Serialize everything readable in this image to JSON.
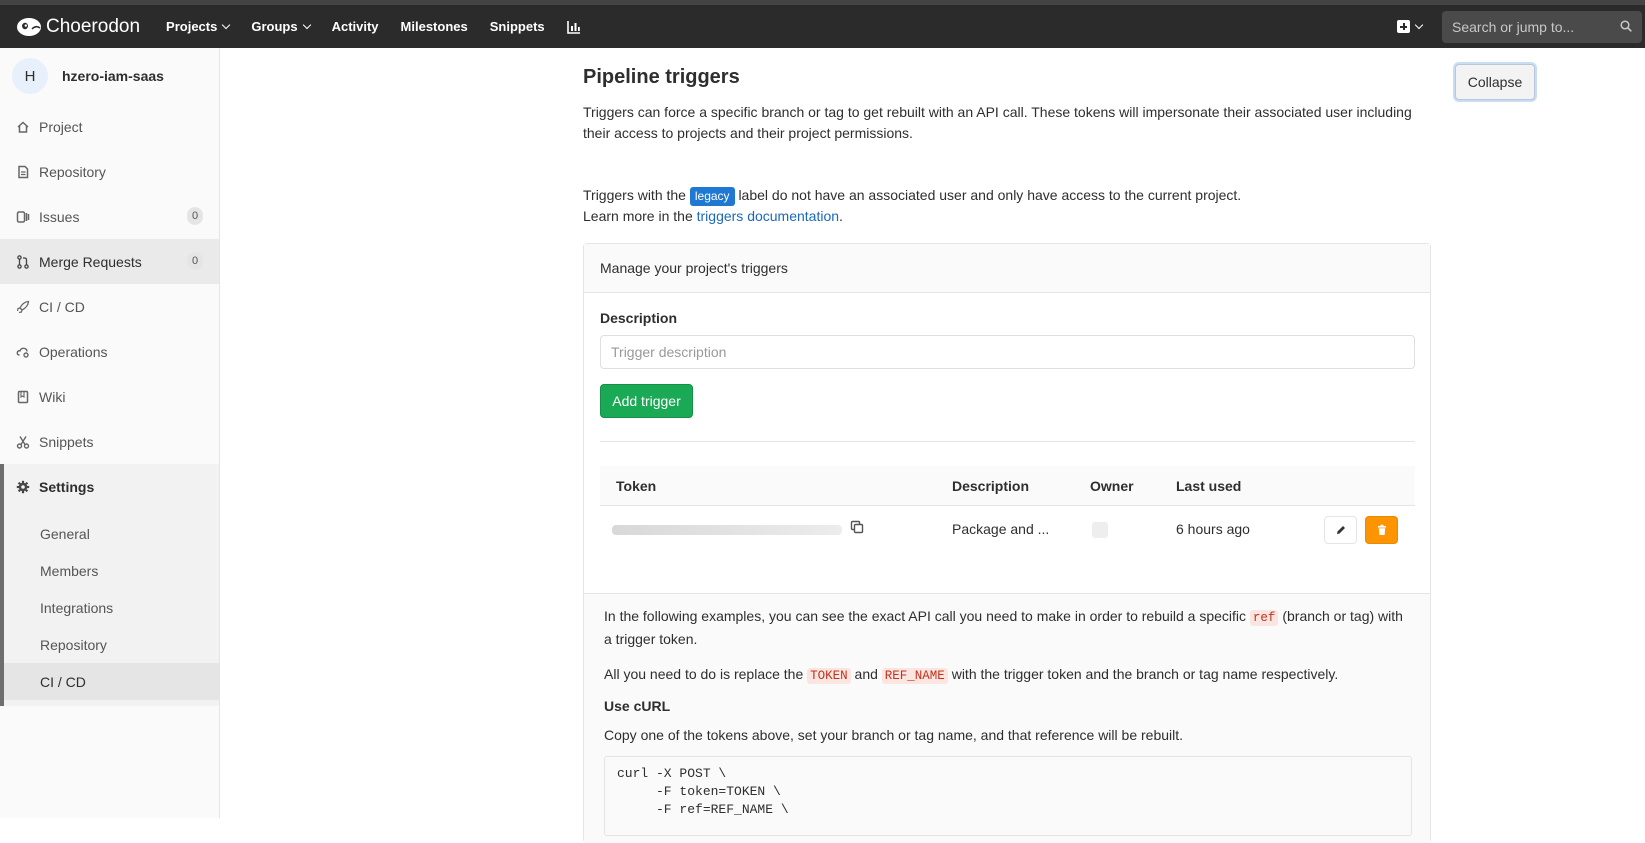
{
  "topnav": {
    "brand": "Choerodon",
    "items": [
      {
        "label": "Projects",
        "caret": true
      },
      {
        "label": "Groups",
        "caret": true
      },
      {
        "label": "Activity",
        "caret": false
      },
      {
        "label": "Milestones",
        "caret": false
      },
      {
        "label": "Snippets",
        "caret": false
      }
    ],
    "search_placeholder": "Search or jump to..."
  },
  "sidebar": {
    "avatar_letter": "H",
    "project_name": "hzero-iam-saas",
    "items": [
      {
        "label": "Project",
        "icon": "home-icon"
      },
      {
        "label": "Repository",
        "icon": "doc-icon"
      },
      {
        "label": "Issues",
        "icon": "issues-icon",
        "badge": "0"
      },
      {
        "label": "Merge Requests",
        "icon": "merge-request-icon",
        "badge": "0"
      },
      {
        "label": "CI / CD",
        "icon": "rocket-icon"
      },
      {
        "label": "Operations",
        "icon": "cloud-gear-icon"
      },
      {
        "label": "Wiki",
        "icon": "book-icon"
      },
      {
        "label": "Snippets",
        "icon": "scissors-icon"
      }
    ],
    "settings": {
      "label": "Settings",
      "sub": [
        "General",
        "Members",
        "Integrations",
        "Repository",
        "CI / CD"
      ]
    }
  },
  "main": {
    "title": "Pipeline triggers",
    "collapse_label": "Collapse",
    "intro": "Triggers can force a specific branch or tag to get rebuilt with an API call. These tokens will impersonate their associated user including their access to projects and their project permissions.",
    "legacy_prefix": "Triggers with the",
    "legacy_badge": "legacy",
    "legacy_suffix": "label do not have an associated user and only have access to the current project.",
    "learn_prefix": "Learn more in the",
    "learn_link": "triggers documentation",
    "learn_suffix": ".",
    "panel": {
      "header": "Manage your project's triggers",
      "description_label": "Description",
      "description_placeholder": "Trigger description",
      "add_button": "Add trigger",
      "columns": [
        "Token",
        "Description",
        "Owner",
        "Last used"
      ],
      "row": {
        "description": "Package and ...",
        "last_used": "6 hours ago"
      }
    },
    "examples": {
      "p1_a": "In the following examples, you can see the exact API call you need to make in order to rebuild a specific",
      "p1_code": "ref",
      "p1_b": "(branch or tag) with a trigger token.",
      "p2_a": "All you need to do is replace the",
      "p2_code1": "TOKEN",
      "p2_and": "and",
      "p2_code2": "REF_NAME",
      "p2_b": "with the trigger token and the branch or tag name respectively.",
      "heading": "Use cURL",
      "p3": "Copy one of the tokens above, set your branch or tag name, and that reference will be rebuilt.",
      "code": "curl -X POST \\\n     -F token=TOKEN \\\n     -F ref=REF_NAME \\"
    }
  }
}
